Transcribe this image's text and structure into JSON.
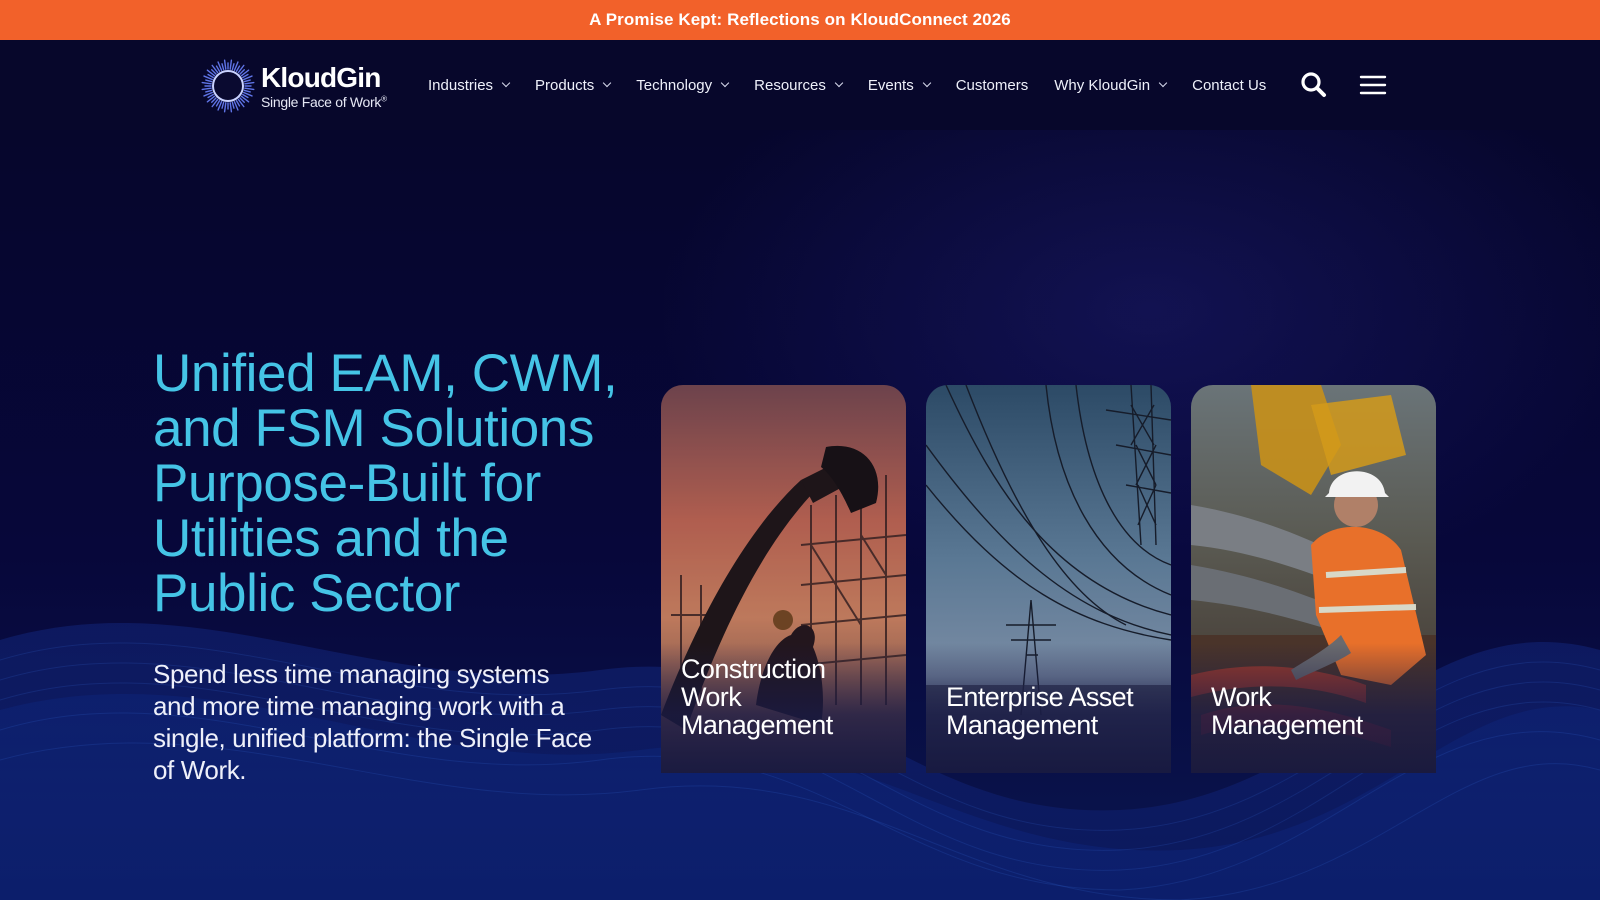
{
  "announcement": {
    "text": "A Promise Kept: Reflections on KloudConnect 2026"
  },
  "brand": {
    "name": "KloudGin",
    "tagline": "Single Face of Work",
    "trademark": "®"
  },
  "nav": {
    "items": [
      {
        "label": "Industries",
        "has_dropdown": true
      },
      {
        "label": "Products",
        "has_dropdown": true
      },
      {
        "label": "Technology",
        "has_dropdown": true
      },
      {
        "label": "Resources",
        "has_dropdown": true
      },
      {
        "label": "Events",
        "has_dropdown": true
      },
      {
        "label": "Customers",
        "has_dropdown": false
      },
      {
        "label": "Why KloudGin",
        "has_dropdown": true
      },
      {
        "label": "Contact Us",
        "has_dropdown": false
      }
    ],
    "search_icon": "search-icon",
    "menu_icon": "hamburger-menu-icon"
  },
  "hero": {
    "title": "Unified EAM, CWM, and FSM Solutions Purpose-Built for Utilities and the Public Sector",
    "subtitle": "Spend less time managing systems and more time managing work with a single, unified platform: the Single Face of Work."
  },
  "cards": [
    {
      "label": "Construction Work Management"
    },
    {
      "label": "Enterprise Asset Management"
    },
    {
      "label": "Work Management"
    }
  ],
  "colors": {
    "announcement_bg": "#f2612a",
    "page_bg": "#05052a",
    "hero_title": "#45c4e6",
    "text": "#ffffff"
  }
}
